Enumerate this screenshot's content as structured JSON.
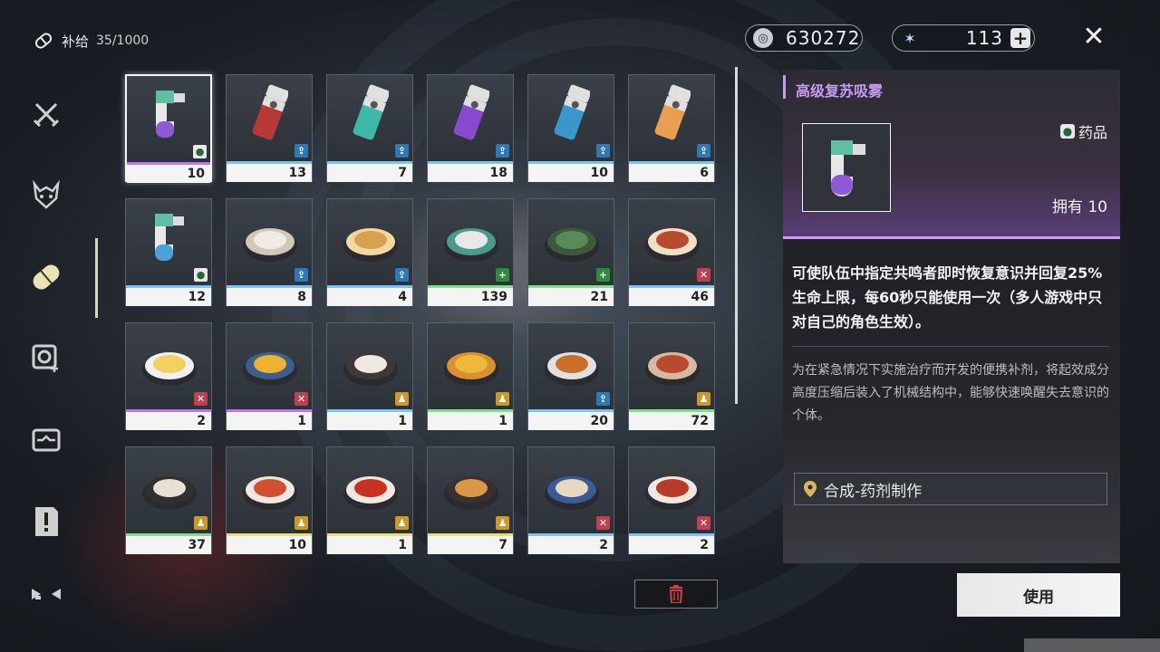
{
  "header": {
    "supply_label": "补给",
    "supply_count": "35/1000"
  },
  "currency": {
    "shell_value": "630272",
    "energy_value": "113",
    "plus_label": "+"
  },
  "sidebar": {
    "items": [
      {
        "icon": "crossed-swords-icon"
      },
      {
        "icon": "demon-mask-icon"
      },
      {
        "icon": "supply-capsule-icon"
      },
      {
        "icon": "gear-plus-icon"
      },
      {
        "icon": "box-icon"
      },
      {
        "icon": "exclamation-icon"
      },
      {
        "icon": "arrows-icon"
      }
    ]
  },
  "grid": {
    "items": [
      {
        "count": "10",
        "tag": "teal",
        "bar": "#b978ec",
        "art": "inhaler-purple"
      },
      {
        "count": "13",
        "tag": "blue",
        "bar": "#7cc4f4",
        "art": "can-red"
      },
      {
        "count": "7",
        "tag": "blue",
        "bar": "#7cc4f4",
        "art": "can-teal"
      },
      {
        "count": "18",
        "tag": "blue",
        "bar": "#7cc4f4",
        "art": "can-purple"
      },
      {
        "count": "10",
        "tag": "blue",
        "bar": "#7cc4f4",
        "art": "can-blue"
      },
      {
        "count": "6",
        "tag": "blue",
        "bar": "#7cc4f4",
        "art": "can-orange"
      },
      {
        "count": "12",
        "tag": "teal",
        "bar": "#7cc4f4",
        "art": "inhaler-blue"
      },
      {
        "count": "8",
        "tag": "blue",
        "bar": "#7cc4f4",
        "art": "bun"
      },
      {
        "count": "4",
        "tag": "blue",
        "bar": "#7cc4f4",
        "art": "bun-glazed"
      },
      {
        "count": "139",
        "tag": "green",
        "bar": "#7ee08a",
        "art": "pill-pack"
      },
      {
        "count": "21",
        "tag": "green",
        "bar": "#7ee08a",
        "art": "bag"
      },
      {
        "count": "46",
        "tag": "red",
        "bar": "#7cc4f4",
        "art": "skewers"
      },
      {
        "count": "2",
        "tag": "red",
        "bar": "#b978ec",
        "art": "omelette"
      },
      {
        "count": "1",
        "tag": "red",
        "bar": "#b978ec",
        "art": "egg-dish"
      },
      {
        "count": "1",
        "tag": "yellow",
        "bar": "#7cc4f4",
        "art": "dumplings"
      },
      {
        "count": "1",
        "tag": "yellow",
        "bar": "#7ee08a",
        "art": "fried-plate"
      },
      {
        "count": "20",
        "tag": "blue",
        "bar": "#7cc4f4",
        "art": "tea-set"
      },
      {
        "count": "72",
        "tag": "yellow",
        "bar": "#7ee08a",
        "art": "fish-stew"
      },
      {
        "count": "37",
        "tag": "yellow",
        "bar": "#7ee08a",
        "art": "soup-bowl"
      },
      {
        "count": "10",
        "tag": "yellow",
        "bar": "#e8e070",
        "art": "chicken"
      },
      {
        "count": "1",
        "tag": "yellow",
        "bar": "#e8e070",
        "art": "mapo"
      },
      {
        "count": "7",
        "tag": "yellow",
        "bar": "#e8e070",
        "art": "tofu"
      },
      {
        "count": "2",
        "tag": "red",
        "bar": "#7cc4f4",
        "art": "shumai"
      },
      {
        "count": "2",
        "tag": "red",
        "bar": "#7cc4f4",
        "art": "pork"
      }
    ]
  },
  "detail": {
    "title": "高级复苏吸雾",
    "category": "药品",
    "owned": "拥有 10",
    "description": "可使队伍中指定共鸣者即时恢复意识并回复25%生命上限，每60秒只能使用一次（多人游戏中只对自己的角色生效）。",
    "flavor": "为在紧急情况下实施治疗而开发的便携补剂，将起效成分高度压缩后装入了机械结构中，能够快速唤醒失去意识的个体。",
    "source": "合成-药剂制作",
    "use_button": "使用"
  },
  "colors": {
    "title_purple": "#c79bf2",
    "rarity_purple": "#b978ec",
    "rarity_blue": "#7cc4f4",
    "rarity_green": "#7ee08a",
    "rarity_gold": "#e8e070"
  }
}
